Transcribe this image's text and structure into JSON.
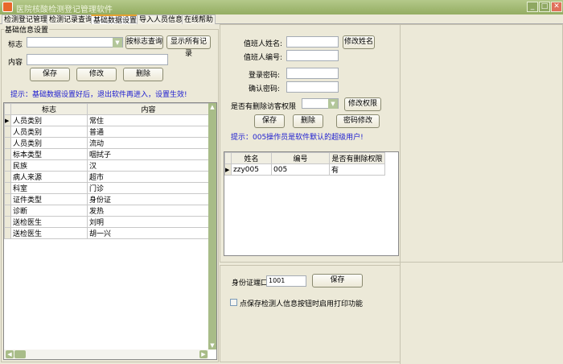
{
  "window": {
    "title": "医院核酸检测登记管理软件",
    "minimize": "_",
    "maximize": "□",
    "close": "✕"
  },
  "tabs": [
    {
      "label": "检测登记管理"
    },
    {
      "label": "检测记录查询"
    },
    {
      "label": "基础数据设置"
    },
    {
      "label": "导入人员信息"
    },
    {
      "label": "在线帮助"
    }
  ],
  "left": {
    "group_title": "基础信息设置",
    "flag_label": "标志",
    "flag_value": "",
    "content_label": "内容",
    "content_value": "",
    "query_btn": "按标志查询",
    "show_all_btn": "显示所有记录",
    "save_btn": "保存",
    "edit_btn": "修改",
    "delete_btn": "删除",
    "hint": "提示：基础数据设置好后，退出软件再进入，设置生效!",
    "grid": {
      "columns": [
        "标志",
        "内容"
      ],
      "rows": [
        [
          "人员类别",
          "常住"
        ],
        [
          "人员类别",
          "普通"
        ],
        [
          "人员类别",
          "流动"
        ],
        [
          "标本类型",
          "咽拭子"
        ],
        [
          "民族",
          "汉"
        ],
        [
          "病人来源",
          "超市"
        ],
        [
          "科室",
          "门诊"
        ],
        [
          "证件类型",
          "身份证"
        ],
        [
          "诊断",
          "发热"
        ],
        [
          "送检医生",
          "刘明"
        ],
        [
          "送检医生",
          "胡一兴"
        ]
      ]
    }
  },
  "operator": {
    "name_label": "值班人姓名:",
    "name_value": "",
    "rename_btn": "修改姓名",
    "id_label": "值班人编号:",
    "id_value": "",
    "pwd_label": "登录密码:",
    "pwd_value": "",
    "confirm_label": "确认密码:",
    "confirm_value": "",
    "perm_label": "是否有删除访客权限",
    "perm_value": "",
    "perm_btn": "修改权限",
    "save_btn": "保存",
    "delete_btn": "删除",
    "pwd_btn": "密码修改",
    "hint": "提示：005操作员是软件默认的超级用户!",
    "grid": {
      "columns": [
        "姓名",
        "编号",
        "是否有删除权限"
      ],
      "rows": [
        [
          "zzy005",
          "005",
          "有"
        ]
      ]
    }
  },
  "port": {
    "label": "身份证端口",
    "value": "1001",
    "save_btn": "保存",
    "print_checkbox": "点保存检测人信息按钮时启用打印功能",
    "print_checked": false
  }
}
